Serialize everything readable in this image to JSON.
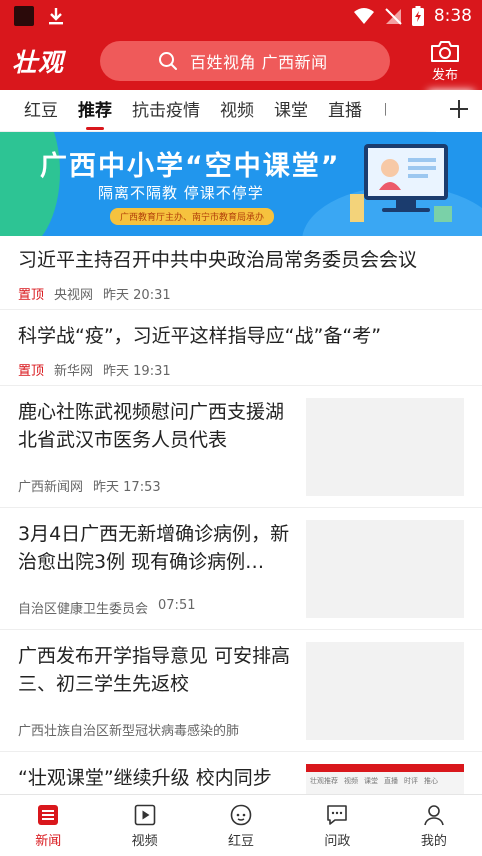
{
  "status_bar": {
    "time": "8:38"
  },
  "header": {
    "logo": "壮观",
    "search_placeholder": "百姓视角 广西新闻",
    "publish_label": "发布"
  },
  "tabs": [
    "红豆",
    "推荐",
    "抗击疫情",
    "视频",
    "课堂",
    "直播",
    "时"
  ],
  "active_tab": "推荐",
  "banner": {
    "title": "广西中小学“空中课堂”",
    "subtitle": "隔离不隔教  停课不停学",
    "tag": "广西教育厅主办、南宁市教育局承办"
  },
  "feed": [
    {
      "title": "习近平主持召开中共中央政治局常务委员会会议",
      "pin": "置顶",
      "source": "央视网",
      "time": "昨天 20:31"
    },
    {
      "title": "科学战“疫”，习近平这样指导应“战”备“考”",
      "pin": "置顶",
      "source": "新华网",
      "time": "昨天 19:31"
    },
    {
      "title": "鹿心社陈武视频慰问广西支援湖北省武汉市医务人员代表",
      "source": "广西新闻网",
      "time": "昨天 17:53"
    },
    {
      "title": "3月4日广西无新增确诊病例，新治愈出院3例 现有确诊病例…",
      "source": "自治区健康卫生委员会",
      "time": "07:51"
    },
    {
      "title": "广西发布开学指导意见 可安排高三、初三学生先返校",
      "source": "广西壮族自治区新型冠状病毒感染的肺"
    },
    {
      "title": "“壮观课堂”继续升级 校内同步"
    }
  ],
  "thumb_tabs": [
    "壮观推荐",
    "视频",
    "课堂",
    "直播",
    "时评",
    "推心"
  ],
  "bottom_nav": [
    {
      "label": "新闻",
      "icon": "news-icon"
    },
    {
      "label": "视频",
      "icon": "video-icon"
    },
    {
      "label": "红豆",
      "icon": "hongdou-icon"
    },
    {
      "label": "问政",
      "icon": "wenzheng-icon"
    },
    {
      "label": "我的",
      "icon": "profile-icon"
    }
  ],
  "colors": {
    "brand_red": "#d9171c",
    "banner_blue": "#2196ed"
  }
}
